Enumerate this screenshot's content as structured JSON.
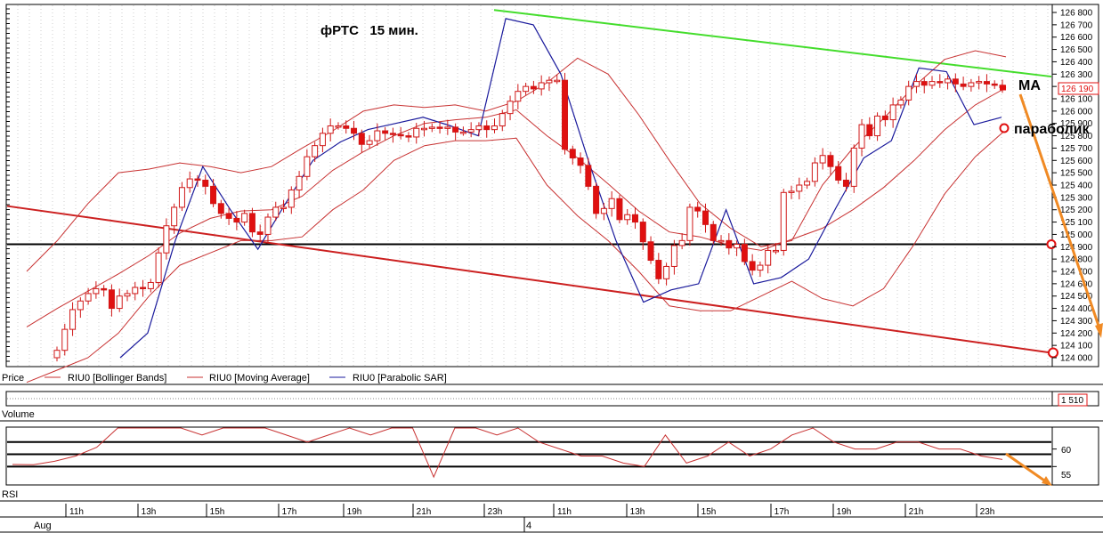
{
  "chart_data": [
    {
      "type": "candlestick",
      "title": "фРТС   15 мин.",
      "panel_label": "Price",
      "ylim": [
        124000,
        126820
      ],
      "y_ticks": [
        124000,
        124100,
        124200,
        124300,
        124400,
        124500,
        124600,
        124700,
        124800,
        124900,
        125000,
        125100,
        125200,
        125300,
        125400,
        125500,
        125600,
        125700,
        125800,
        125900,
        126000,
        126100,
        126200,
        126300,
        126400,
        126500,
        126600,
        126700,
        126800
      ],
      "y_tick_labels": [
        "124 000",
        "124 100",
        "124 200",
        "124 300",
        "124 400",
        "124 500",
        "124 600",
        "124 700",
        "124 800",
        "124 900",
        "125 000",
        "125 100",
        "125 200",
        "125 300",
        "125 400",
        "125 500",
        "125 600",
        "125 700",
        "125 800",
        "125 900",
        "126 000",
        "126 100",
        "126 200",
        "126 300",
        "126 400",
        "126 500",
        "126 600",
        "126 700",
        "126 800"
      ],
      "last_price_label": "126 190",
      "candles_close": [
        124060,
        124230,
        124390,
        124460,
        124520,
        124560,
        124550,
        124400,
        124500,
        124520,
        124570,
        124560,
        124610,
        124850,
        125070,
        125220,
        125380,
        125450,
        125440,
        125390,
        125250,
        125170,
        125130,
        125100,
        125170,
        125020,
        125000,
        125140,
        125220,
        125220,
        125360,
        125470,
        125630,
        125720,
        125820,
        125880,
        125880,
        125860,
        125820,
        125730,
        125760,
        125840,
        125820,
        125810,
        125800,
        125790,
        125860,
        125860,
        125870,
        125860,
        125870,
        125830,
        125830,
        125850,
        125880,
        125850,
        125880,
        125980,
        126080,
        126160,
        126200,
        126180,
        126230,
        126250,
        126250,
        125690,
        125620,
        125560,
        125390,
        125170,
        125210,
        125290,
        125120,
        125160,
        125100,
        124940,
        124790,
        124640,
        124740,
        124910,
        124950,
        125220,
        125190,
        125080,
        124950,
        124950,
        124890,
        124920,
        124780,
        124710,
        124750,
        124870,
        124870,
        125340,
        125350,
        125400,
        125430,
        125580,
        125640,
        125550,
        125440,
        125390,
        125700,
        125890,
        125800,
        125960,
        125930,
        126050,
        126090,
        126200,
        126240,
        126210,
        126240,
        126230,
        126260,
        126220,
        126200,
        126230,
        126240,
        126220,
        126210,
        126190
      ],
      "ma": [
        124250,
        124400,
        124540,
        124680,
        124830,
        125010,
        125130,
        125190,
        125200,
        125310,
        125520,
        125670,
        125800,
        125900,
        125930,
        125950,
        126010,
        125800,
        125620,
        125410,
        125190,
        125020,
        124980,
        124910,
        124870,
        124960,
        125050,
        125200,
        125380,
        125600,
        125850,
        126050,
        126190
      ],
      "bollinger_upper": [
        124700,
        124950,
        125250,
        125500,
        125530,
        125580,
        125550,
        125500,
        125550,
        125700,
        125840,
        126000,
        126050,
        126030,
        126050,
        126000,
        126080,
        126230,
        126430,
        126300,
        125970,
        125600,
        125250,
        125050,
        124900,
        124950,
        125400,
        125700,
        125940,
        126200,
        126420,
        126490,
        126440
      ],
      "bollinger_lower": [
        123800,
        123900,
        124000,
        124200,
        124500,
        124750,
        124850,
        124950,
        124950,
        124980,
        125200,
        125360,
        125600,
        125720,
        125760,
        125760,
        125780,
        125400,
        125150,
        124950,
        124700,
        124420,
        124380,
        124380,
        124500,
        124620,
        124480,
        124420,
        124560,
        124920,
        125330,
        125630,
        125850
      ],
      "parabolic_sar": [
        124000,
        124200,
        124950,
        125550,
        125200,
        124880,
        125250,
        125600,
        125750,
        125850,
        125900,
        125950,
        125880,
        125800,
        126750,
        126700,
        126300,
        125600,
        124950,
        124450,
        124550,
        124600,
        125200,
        124600,
        124650,
        124800,
        125220,
        125620,
        125760,
        126350,
        126320,
        125890,
        125950
      ],
      "support_line": {
        "start": 125230,
        "end": 124040
      },
      "resistance_line": {
        "start": 126820,
        "end": 126280
      },
      "horizontal_level": 124920,
      "legend": [
        "RIU0 [Bollinger Bands]",
        "RIU0 [Moving Average]",
        "RIU0 [Parabolic SAR]"
      ],
      "annotations": [
        "MA",
        "параболик"
      ],
      "colors": {
        "up": "#ffffff",
        "down": "#e01010",
        "bollinger": "#c83232",
        "ma": "#c83232",
        "sar": "#1a1a9c",
        "support": "#cc2020",
        "resistance": "#44dd2c",
        "level": "#000000",
        "arrow": "#f08a24"
      }
    },
    {
      "type": "bar",
      "panel_label": "Volume",
      "value_label": "1 510"
    },
    {
      "type": "line",
      "panel_label": "RSI",
      "ylim": [
        50,
        66
      ],
      "y_tick_labels": [
        "60",
        "55"
      ],
      "levels": [
        62,
        58.5,
        55
      ],
      "values": [
        55.6,
        55.5,
        56.5,
        58,
        60.5,
        67,
        70,
        68,
        66,
        64,
        66,
        68,
        66,
        64,
        62,
        64,
        66,
        64,
        66,
        68,
        52,
        70,
        68,
        64,
        70,
        62,
        60,
        58,
        58,
        56,
        55,
        64,
        56,
        58,
        62,
        58,
        60,
        64,
        66,
        62,
        60,
        60,
        62,
        62,
        60,
        60,
        58,
        57
      ]
    }
  ],
  "x_axis": {
    "hour_labels": [
      "11h",
      "13h",
      "15h",
      "17h",
      "19h",
      "21h",
      "23h",
      "11h",
      "13h",
      "15h",
      "17h",
      "19h",
      "21h",
      "23h"
    ],
    "date_labels": [
      "Aug",
      "4"
    ]
  }
}
